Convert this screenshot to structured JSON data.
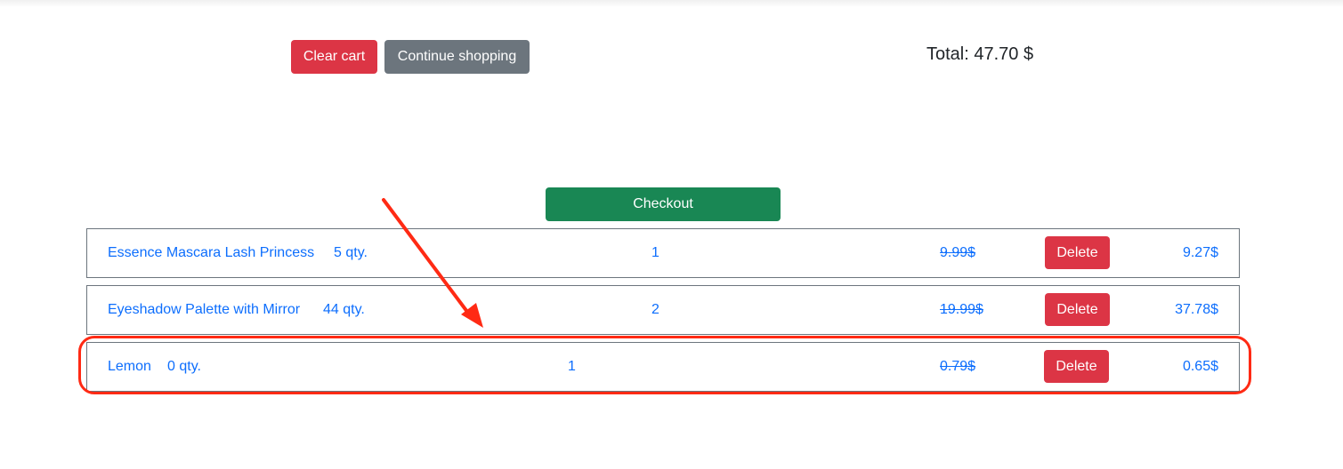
{
  "toolbar": {
    "clear_cart_label": "Clear cart",
    "continue_shopping_label": "Continue shopping"
  },
  "total": {
    "text": "Total: 47.70 $"
  },
  "checkout": {
    "label": "Checkout"
  },
  "cart_items": [
    {
      "name": "Essence Mascara Lash Princess",
      "stock": "5 qty.",
      "quantity": "1",
      "old_price": "9.99$",
      "delete_label": "Delete",
      "price": "9.27$"
    },
    {
      "name": "Eyeshadow Palette with Mirror",
      "stock": "44 qty.",
      "quantity": "2",
      "old_price": "19.99$",
      "delete_label": "Delete",
      "price": "37.78$"
    },
    {
      "name": "Lemon",
      "stock": "0 qty.",
      "quantity": "1",
      "old_price": "0.79$",
      "delete_label": "Delete",
      "price": "0.65$"
    }
  ],
  "colors": {
    "danger": "#dc3545",
    "secondary": "#6c757d",
    "success": "#198754",
    "link": "#0d6efd",
    "annotation": "#ff2a14"
  },
  "annotation": {
    "arrow_icon": "arrow-icon",
    "highlight": "highlight-outline"
  }
}
